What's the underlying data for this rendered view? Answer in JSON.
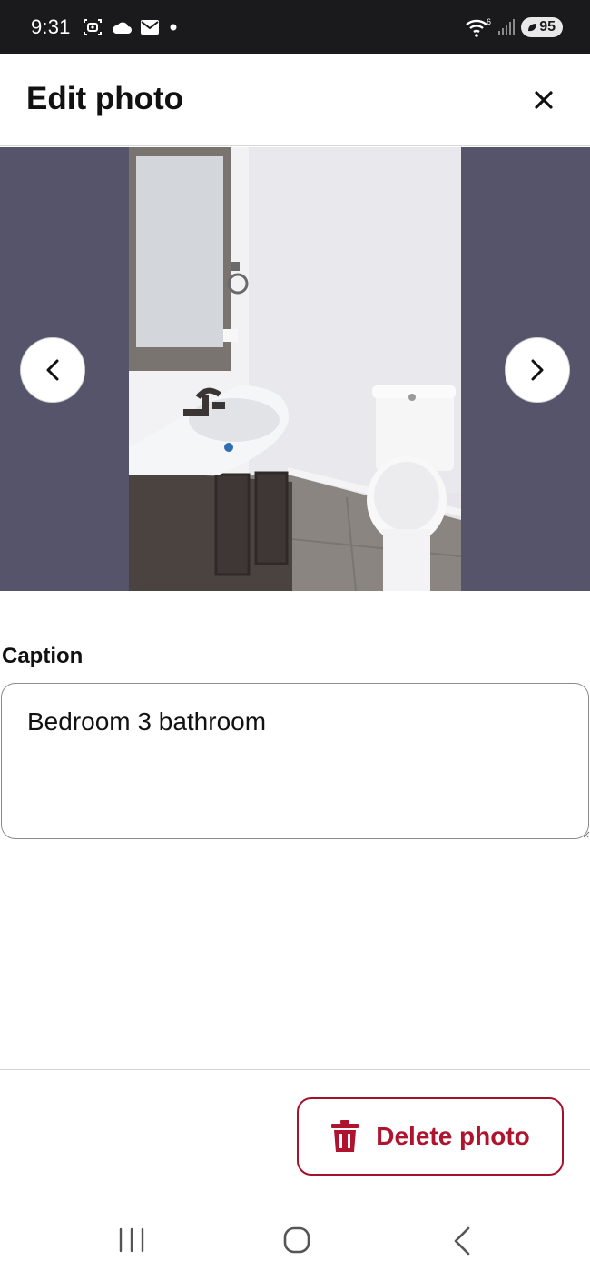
{
  "status_bar": {
    "time": "9:31",
    "network": "6",
    "battery": "95",
    "left_icons": [
      "screen-record-icon",
      "cloud-icon",
      "mail-icon",
      "dot-icon"
    ],
    "right_icons": [
      "wifi-icon",
      "signal-icon",
      "battery-icon"
    ]
  },
  "header": {
    "title": "Edit photo",
    "close_icon": "close-icon"
  },
  "viewer": {
    "photo_subject": "bathroom-photo",
    "prev_icon": "chevron-left-icon",
    "next_icon": "chevron-right-icon",
    "background_color": "#55546b"
  },
  "caption": {
    "label": "Caption",
    "value": "Bedroom 3 bathroom"
  },
  "actions": {
    "delete_label": "Delete photo",
    "delete_icon": "trash-icon",
    "accent_color": "#b0132d"
  },
  "android_nav": {
    "icons": [
      "recents-icon",
      "home-icon",
      "back-icon"
    ]
  }
}
